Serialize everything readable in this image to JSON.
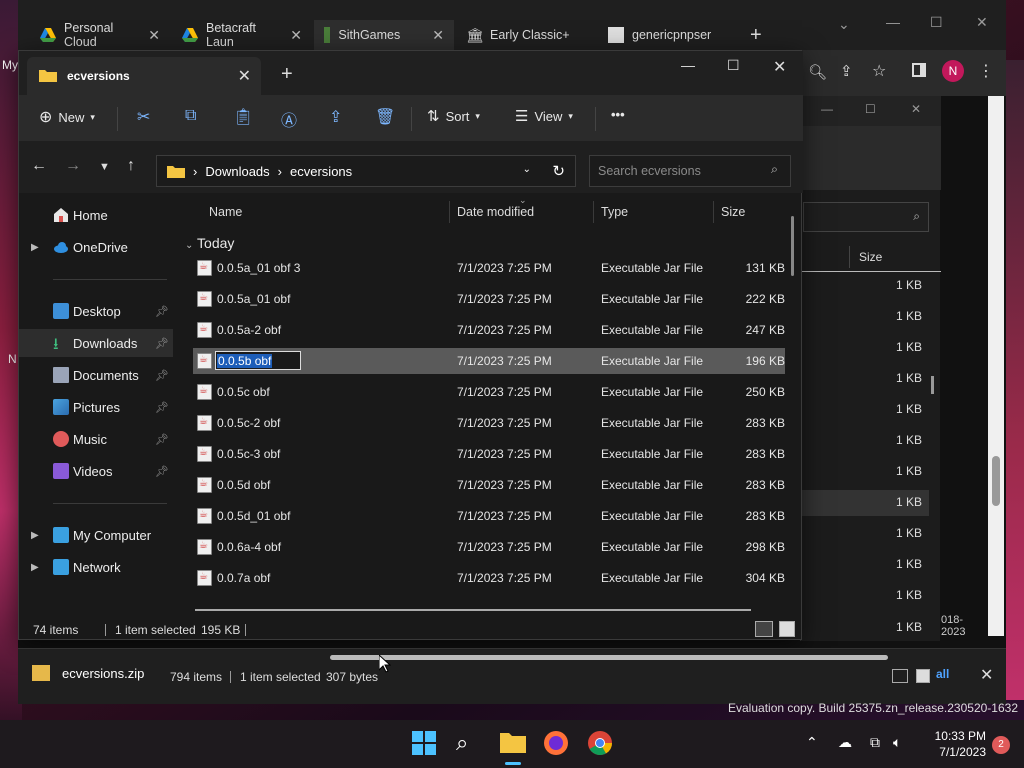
{
  "chrome": {
    "tabs": [
      {
        "label": "Personal Cloud"
      },
      {
        "label": "Betacraft Laun"
      },
      {
        "label": "SithGames"
      },
      {
        "label": "Early Classic+"
      },
      {
        "label": "genericpnpser"
      }
    ],
    "new_tab": "+",
    "profile_initial": "N"
  },
  "explorer2": {
    "column_size": "Size",
    "sizes": [
      "1 KB",
      "1 KB",
      "1 KB",
      "1 KB",
      "1 KB",
      "1 KB",
      "1 KB",
      "1 KB",
      "1 KB",
      "1 KB",
      "1 KB",
      "1 KB"
    ],
    "date_fragment": "018-2023",
    "status_items": "794 items",
    "status_selected": "1 item selected",
    "status_bytes": "307 bytes",
    "link_all": "all",
    "close": "✕"
  },
  "explorer": {
    "tab_title": "ecversions",
    "cmd": {
      "new": "New",
      "sort": "Sort",
      "view": "View",
      "more": "•••"
    },
    "address": {
      "segments": [
        "Downloads",
        "ecversions"
      ]
    },
    "search_placeholder": "Search ecversions",
    "sidebar": {
      "home": "Home",
      "onedrive": "OneDrive",
      "desktop": "Desktop",
      "downloads": "Downloads",
      "documents": "Documents",
      "pictures": "Pictures",
      "music": "Music",
      "videos": "Videos",
      "mycomputer": "My Computer",
      "network": "Network"
    },
    "columns": {
      "name": "Name",
      "date": "Date modified",
      "type": "Type",
      "size": "Size"
    },
    "group": "Today",
    "files": [
      {
        "name": "0.0.5a_01 obf 3",
        "date": "7/1/2023 7:25 PM",
        "type": "Executable Jar File",
        "size": "131 KB"
      },
      {
        "name": "0.0.5a_01 obf",
        "date": "7/1/2023 7:25 PM",
        "type": "Executable Jar File",
        "size": "222 KB"
      },
      {
        "name": "0.0.5a-2 obf",
        "date": "7/1/2023 7:25 PM",
        "type": "Executable Jar File",
        "size": "247 KB"
      },
      {
        "name": "0.0.5b obf",
        "date": "7/1/2023 7:25 PM",
        "type": "Executable Jar File",
        "size": "196 KB"
      },
      {
        "name": "0.0.5c obf",
        "date": "7/1/2023 7:25 PM",
        "type": "Executable Jar File",
        "size": "250 KB"
      },
      {
        "name": "0.0.5c-2 obf",
        "date": "7/1/2023 7:25 PM",
        "type": "Executable Jar File",
        "size": "283 KB"
      },
      {
        "name": "0.0.5c-3 obf",
        "date": "7/1/2023 7:25 PM",
        "type": "Executable Jar File",
        "size": "283 KB"
      },
      {
        "name": "0.0.5d obf",
        "date": "7/1/2023 7:25 PM",
        "type": "Executable Jar File",
        "size": "283 KB"
      },
      {
        "name": "0.0.5d_01 obf",
        "date": "7/1/2023 7:25 PM",
        "type": "Executable Jar File",
        "size": "283 KB"
      },
      {
        "name": "0.0.6a-4 obf",
        "date": "7/1/2023 7:25 PM",
        "type": "Executable Jar File",
        "size": "298 KB"
      },
      {
        "name": "0.0.7a obf",
        "date": "7/1/2023 7:25 PM",
        "type": "Executable Jar File",
        "size": "304 KB"
      }
    ],
    "selected_index": 3,
    "status": {
      "items": "74 items",
      "selected": "1 item selected",
      "size": "195 KB"
    }
  },
  "strip": {
    "zip_name": "ecversions.zip"
  },
  "taskbar": {
    "time": "10:33 PM",
    "date": "7/1/2023",
    "notifications": "2"
  },
  "watermark": "Evaluation copy. Build 25375.zn_release.230520-1632",
  "desktop_fragments": {
    "my": "My",
    "n": "N"
  }
}
